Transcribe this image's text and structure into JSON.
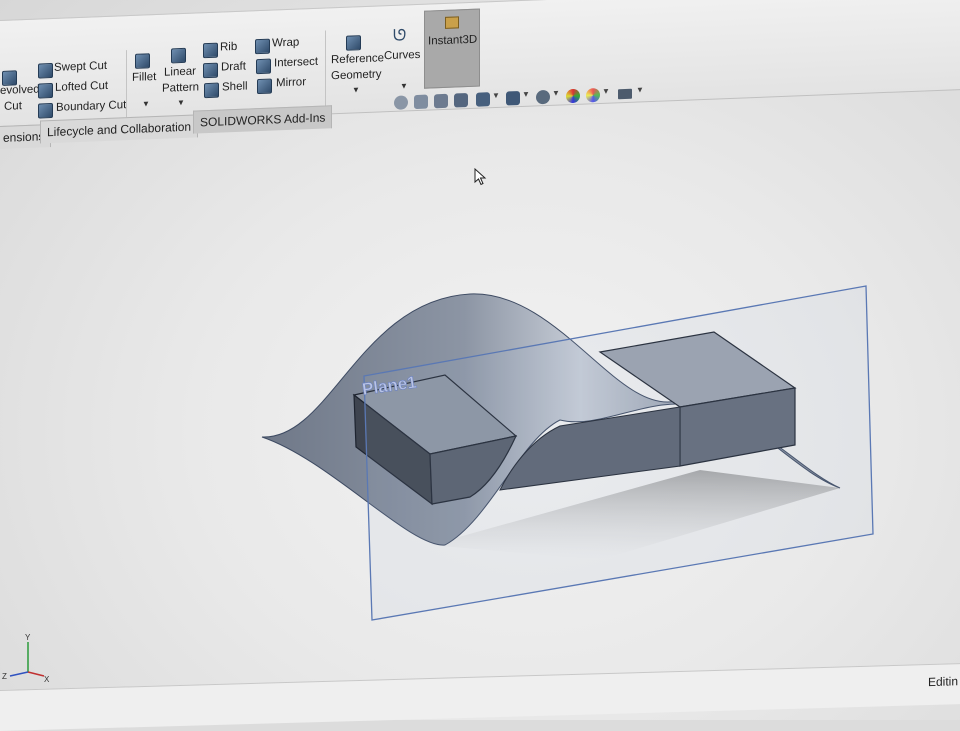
{
  "ribbon": {
    "revolved_cut_label": "evolved",
    "revolved_cut_sub": "Cut",
    "swept_cut": "Swept Cut",
    "lofted_cut": "Lofted Cut",
    "boundary_cut": "Boundary Cut",
    "fillet": "Fillet",
    "linear_pattern": "Linear",
    "linear_pattern_sub": "Pattern",
    "rib": "Rib",
    "draft": "Draft",
    "shell": "Shell",
    "wrap": "Wrap",
    "intersect": "Intersect",
    "mirror": "Mirror",
    "reference_geometry": "Reference",
    "reference_geometry_sub": "Geometry",
    "curves": "Curves",
    "instant3d": "Instant3D"
  },
  "tabs": [
    {
      "label": "ensions"
    },
    {
      "label": "Lifecycle and Collaboration"
    },
    {
      "label": "SOLIDWORKS Add-Ins"
    }
  ],
  "viewport": {
    "plane_label": "Plane1",
    "triad": {
      "y": "Y",
      "x": "X",
      "z": "Z"
    },
    "colors": {
      "plane_edge": "#5a78b4",
      "surface": "#8e97a6",
      "box_top": "#9aa1ad",
      "box_side": "#5f6775",
      "box_front": "#454b56"
    }
  },
  "hud_icons": [
    "zoom-to-fit-icon",
    "zoom-area-icon",
    "previous-view-icon",
    "section-view-icon",
    "view-orientation-icon",
    "display-style-icon",
    "hide-show-icon",
    "appearance-icon",
    "scene-icon",
    "view-settings-icon"
  ],
  "status": {
    "text": "Editin"
  }
}
